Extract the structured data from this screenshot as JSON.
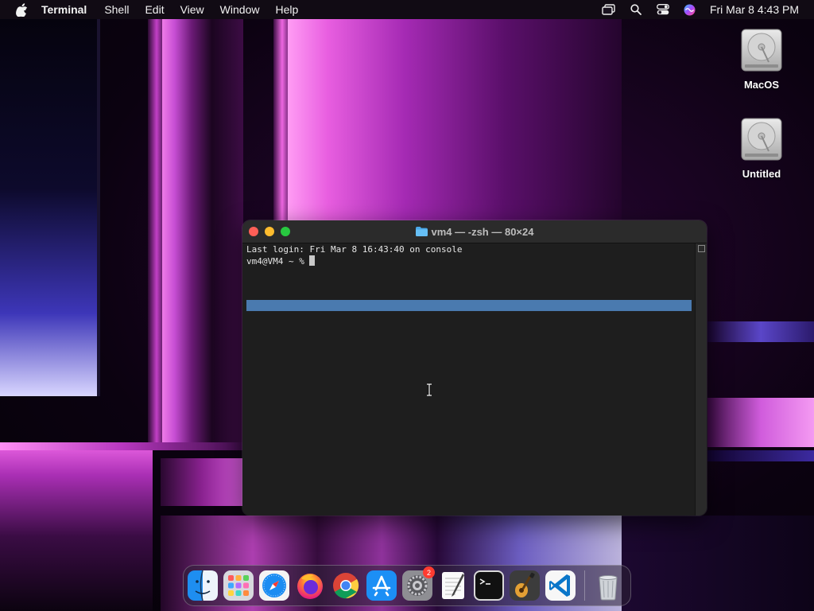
{
  "menubar": {
    "app_name": "Terminal",
    "items": [
      "Shell",
      "Edit",
      "View",
      "Window",
      "Help"
    ],
    "clock": "Fri Mar 8  4:43 PM",
    "status_icons": [
      "screen-mirroring-icon",
      "search-icon",
      "control-center-icon",
      "siri-icon"
    ]
  },
  "desktop": {
    "drives": [
      {
        "label": "MacOS",
        "icon": "hard-drive-icon"
      },
      {
        "label": "Untitled",
        "icon": "hard-drive-icon"
      }
    ]
  },
  "terminal": {
    "title": "vm4 — -zsh — 80×24",
    "lines": [
      "Last login: Fri Mar  8 16:43:40 on console",
      "vm4@VM4 ~ % "
    ],
    "colors": {
      "background": "#1e1e1e",
      "selection": "#4a7aaf",
      "text": "#e6e6e6"
    }
  },
  "dock": {
    "apps": [
      {
        "name": "finder",
        "icon": "finder-icon"
      },
      {
        "name": "launchpad",
        "icon": "launchpad-icon"
      },
      {
        "name": "safari",
        "icon": "safari-icon"
      },
      {
        "name": "firefox",
        "icon": "firefox-icon"
      },
      {
        "name": "chrome",
        "icon": "chrome-icon"
      },
      {
        "name": "app-store",
        "icon": "app-store-icon"
      },
      {
        "name": "system-settings",
        "icon": "settings-gear-icon",
        "badge": "2"
      },
      {
        "name": "textedit",
        "icon": "textedit-icon"
      },
      {
        "name": "terminal",
        "icon": "terminal-icon"
      },
      {
        "name": "instruments",
        "icon": "guitar-icon"
      },
      {
        "name": "vscode",
        "icon": "vscode-icon"
      }
    ],
    "trash": {
      "icon": "trash-icon"
    }
  }
}
